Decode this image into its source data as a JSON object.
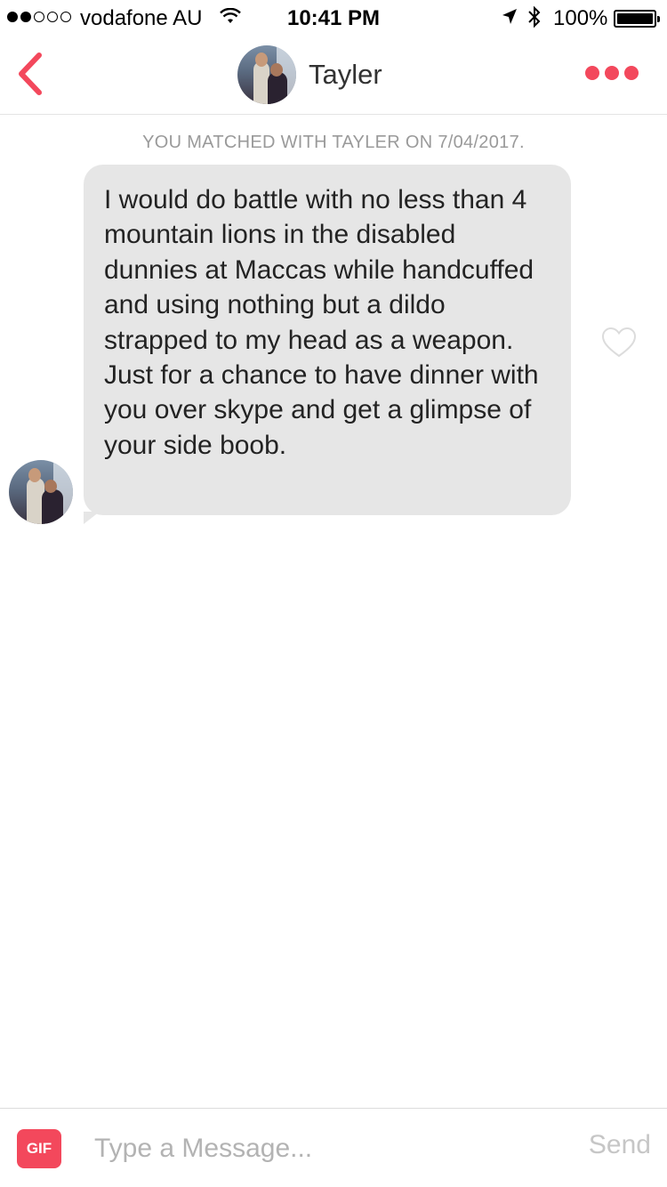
{
  "status_bar": {
    "carrier": "vodafone AU",
    "time": "10:41 PM",
    "battery": "100%",
    "signal_bars_filled": 2,
    "signal_bars_total": 5
  },
  "header": {
    "contact_name": "Tayler",
    "back_icon": "chevron-left-icon",
    "more_icon": "more-dots-icon"
  },
  "conversation": {
    "match_notice": "YOU MATCHED WITH TAYLER ON 7/04/2017.",
    "messages": [
      {
        "text": "I would do battle with no less than 4 mountain lions in the disabled dunnies at Maccas while handcuffed and using nothing but a dildo strapped to my head as a weapon. Just for a chance to have dinner with you over skype and get a glimpse of your side boob."
      }
    ]
  },
  "composer": {
    "gif_label": "GIF",
    "placeholder": "Type a Message...",
    "value": "",
    "send_label": "Send"
  },
  "colors": {
    "accent": "#f3485c",
    "bubble": "#e6e6e6",
    "muted_text": "#9a9a9a"
  }
}
